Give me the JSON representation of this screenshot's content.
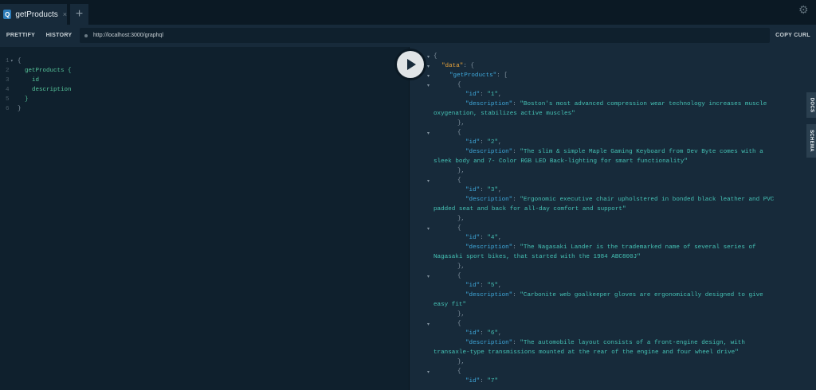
{
  "tab": {
    "badge": "Q",
    "title": "getProducts",
    "close": "×",
    "add": "+"
  },
  "settings_icon": "gear-icon",
  "toolbar": {
    "prettify": "PRETTIFY",
    "history": "HISTORY",
    "url": "http://localhost:3000/graphql",
    "copy_curl": "COPY CURL"
  },
  "query": {
    "lines": [
      {
        "num": "1",
        "code": "{",
        "fold": true
      },
      {
        "num": "2",
        "code": "  getProducts {",
        "fold": false
      },
      {
        "num": "3",
        "code": "    id",
        "fold": false
      },
      {
        "num": "4",
        "code": "    description",
        "fold": false
      },
      {
        "num": "5",
        "code": "  }",
        "fold": false
      },
      {
        "num": "6",
        "code": "}",
        "fold": false
      }
    ]
  },
  "result": {
    "data_key": "\"data\"",
    "list_key": "\"getProducts\"",
    "id_key": "\"id\"",
    "description_key": "\"description\"",
    "items": [
      {
        "id": "\"1\"",
        "description_line1": "\"Boston's most advanced compression wear technology increases muscle",
        "description_line2": "oxygenation, stabilizes active muscles\""
      },
      {
        "id": "\"2\"",
        "description_line1": "\"The slim & simple Maple Gaming Keyboard from Dev Byte comes with a",
        "description_line2": "sleek body and 7- Color RGB LED Back-lighting for smart functionality\""
      },
      {
        "id": "\"3\"",
        "description_line1": "\"Ergonomic executive chair upholstered in bonded black leather and PVC",
        "description_line2": "padded seat and back for all-day comfort and support\""
      },
      {
        "id": "\"4\"",
        "description_line1": "\"The Nagasaki Lander is the trademarked name of several series of",
        "description_line2": "Nagasaki sport bikes, that started with the 1984 ABC800J\""
      },
      {
        "id": "\"5\"",
        "description_line1": "\"Carbonite web goalkeeper gloves are ergonomically designed to give",
        "description_line2": "easy fit\""
      },
      {
        "id": "\"6\"",
        "description_line1": "\"The automobile layout consists of a front-engine design, with",
        "description_line2": "transaxle-type transmissions mounted at the rear of the engine and four wheel drive\""
      },
      {
        "id": "\"7\""
      }
    ]
  },
  "side_tabs": {
    "docs": "DOCS",
    "schema": "SCHEMA"
  }
}
